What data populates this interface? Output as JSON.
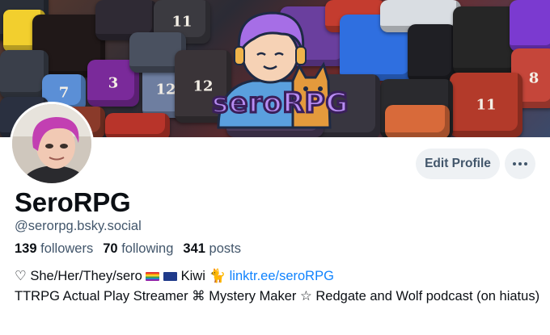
{
  "profile": {
    "display_name": "SeroRPG",
    "handle": "@serorpg.bsky.social",
    "followers_count": "139",
    "followers_label": "followers",
    "following_count": "70",
    "following_label": "following",
    "posts_count": "341",
    "posts_label": "posts",
    "bio_line1_prefix": "♡ She/Her/They/sero",
    "bio_line1_mid": "Kiwi",
    "bio_line1_link": "linktr.ee/seroRPG",
    "bio_line2": "TTRPG Actual Play Streamer ⌘ Mystery Maker ☆ Redgate and Wolf podcast (on hiatus)"
  },
  "banner": {
    "logo_text": "seroRPG"
  },
  "actions": {
    "edit_profile_label": "Edit Profile",
    "more_icon": "ellipsis-icon"
  },
  "colors": {
    "accent_link": "#1083fe",
    "button_bg": "#eef1f4",
    "muted_text": "#42566b"
  }
}
